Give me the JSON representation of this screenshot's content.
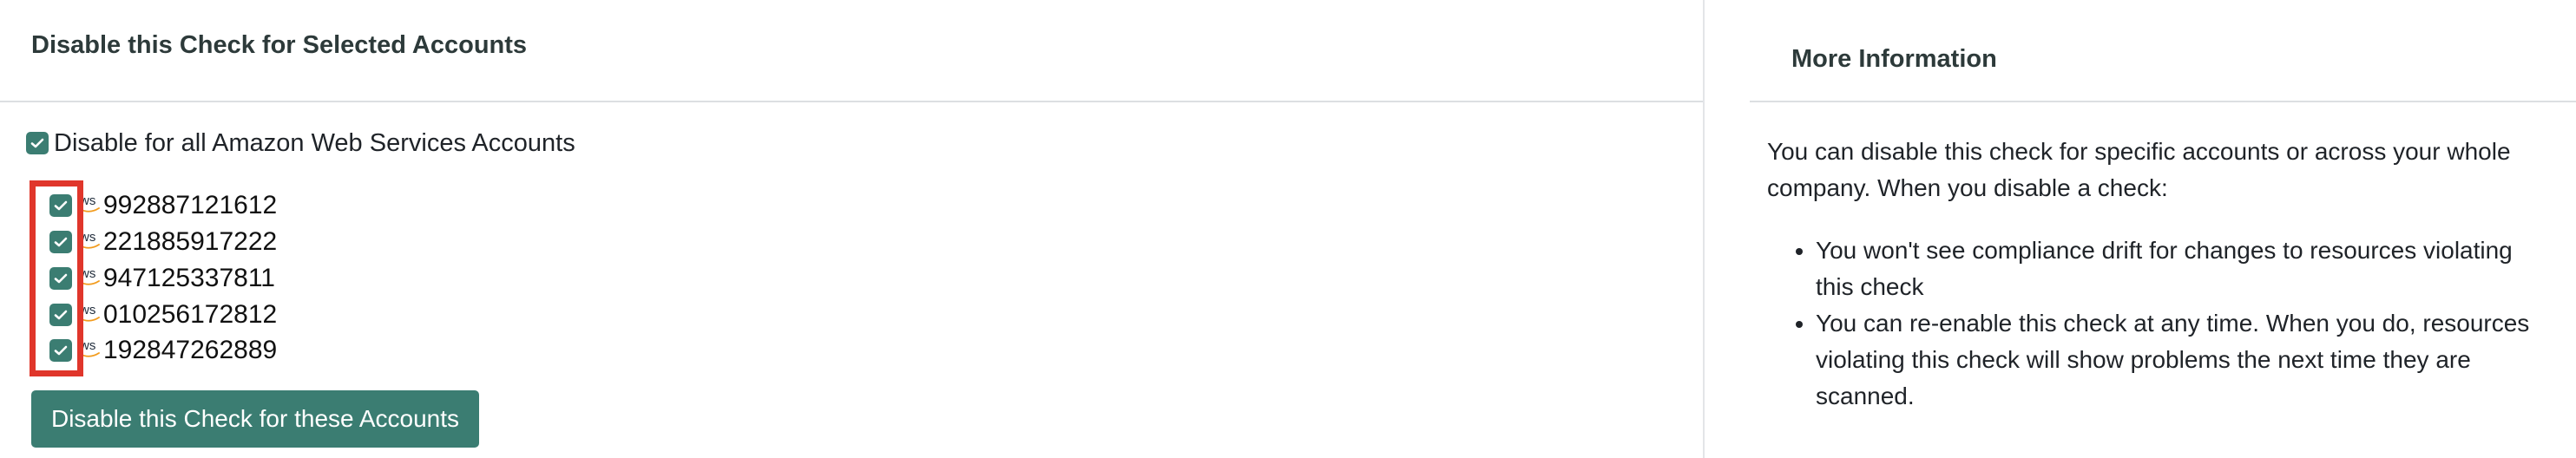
{
  "left_panel": {
    "title": "Disable this Check for Selected Accounts",
    "all_accounts": {
      "label": "Disable for all Amazon Web Services Accounts",
      "checked": true
    },
    "accounts": [
      {
        "logo": "aws-logo-icon",
        "id": "992887121612",
        "checked": true
      },
      {
        "logo": "aws-logo-icon",
        "id": "221885917222",
        "checked": true
      },
      {
        "logo": "aws-logo-icon",
        "id": "947125337811",
        "checked": true
      },
      {
        "logo": "aws-logo-icon",
        "id": "010256172812",
        "checked": true
      },
      {
        "logo": "aws-logo-icon",
        "id": "192847262889",
        "checked": true
      }
    ],
    "button_label": "Disable this Check for these Accounts"
  },
  "right_panel": {
    "title": "More Information",
    "intro": "You can disable this check for specific accounts or across your whole company. When you disable a check:",
    "bullets": [
      "You won't see compliance drift for changes to resources violating this check",
      "You can re-enable this check at any time. When you do, resources violating this check will show problems the next time they are scanned."
    ]
  },
  "colors": {
    "accent": "#3b7d72",
    "highlight_box": "#e0362b",
    "aws_orange": "#f29b1d"
  }
}
